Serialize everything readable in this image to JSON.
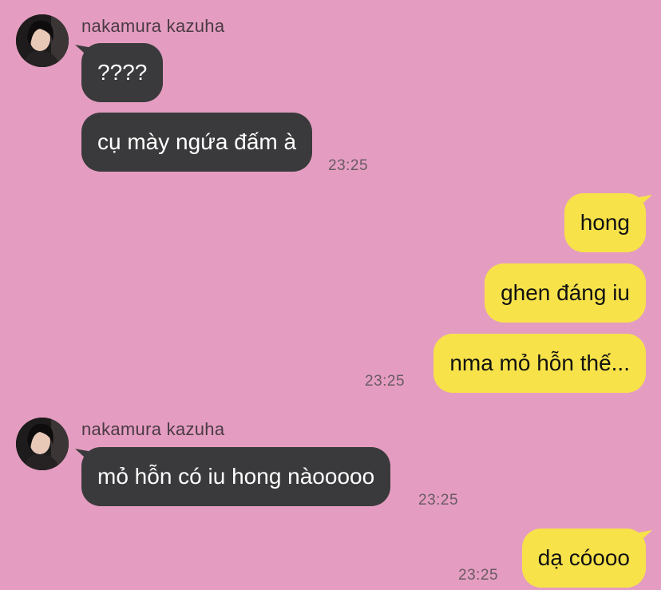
{
  "groups": [
    {
      "sender": "nakamura kazuha",
      "messages": [
        "????",
        "cụ mày ngứa đấm à"
      ],
      "time": "23:25"
    },
    {
      "messages": [
        "hong",
        "ghen đáng iu",
        "nma mỏ hỗn thế..."
      ],
      "time": "23:25"
    },
    {
      "sender": "nakamura kazuha",
      "messages": [
        "mỏ hỗn có iu hong nàooooo"
      ],
      "time": "23:25"
    },
    {
      "messages": [
        "dạ cóooo"
      ],
      "time": "23:25"
    }
  ],
  "colors": {
    "background": "#e49dc0",
    "incoming_bubble": "#3a3a3c",
    "outgoing_bubble": "#f7e24a"
  }
}
